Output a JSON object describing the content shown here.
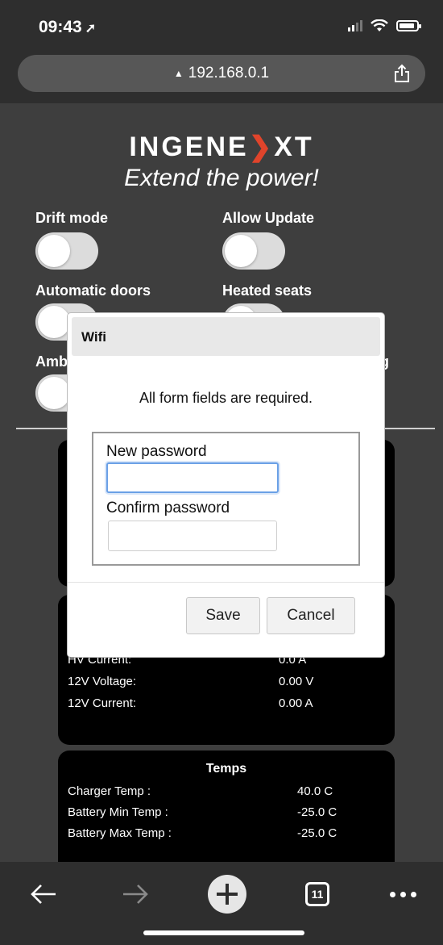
{
  "status_bar": {
    "time": "09:43",
    "location_glyph": "➚"
  },
  "browser": {
    "url": "192.168.0.1",
    "lock_glyph": "▲"
  },
  "brand": {
    "name_prefix": "INGENE",
    "name_mark": "❯",
    "name_suffix": "XT",
    "tagline": "Extend the power!",
    "accent_color": "#e0442b"
  },
  "toggles": [
    {
      "label": "Drift mode"
    },
    {
      "label": "Allow Update"
    },
    {
      "label": "Automatic doors"
    },
    {
      "label": "Heated seats"
    },
    {
      "label": "Amb"
    },
    {
      "label": "g"
    }
  ],
  "cards": {
    "power": {
      "rows": [
        {
          "label": "HV Current:",
          "value": "0.0 A"
        },
        {
          "label": "12V Voltage:",
          "value": "0.00 V"
        },
        {
          "label": "12V Current:",
          "value": "0.00 A"
        }
      ]
    },
    "temps": {
      "title": "Temps",
      "rows": [
        {
          "label": "Charger Temp :",
          "value": "40.0 C"
        },
        {
          "label": "Battery Min Temp :",
          "value": "-25.0 C"
        },
        {
          "label": "Battery Max Temp :",
          "value": "-25.0 C"
        }
      ]
    }
  },
  "modal": {
    "title": "Wifi",
    "note": "All form fields are required.",
    "new_password_label": "New password",
    "new_password_value": "",
    "confirm_password_label": "Confirm password",
    "confirm_password_value": "",
    "save_label": "Save",
    "cancel_label": "Cancel"
  },
  "toolbar": {
    "tab_count": "11"
  }
}
